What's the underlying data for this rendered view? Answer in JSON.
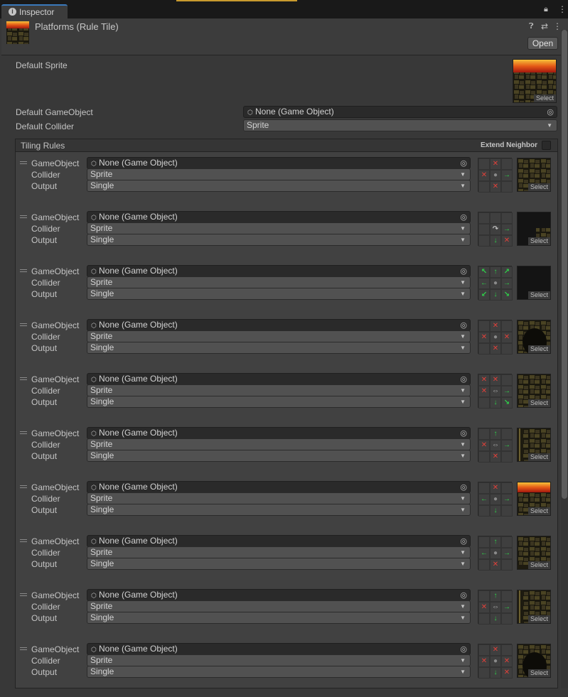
{
  "window": {
    "tab_label": "Inspector",
    "lock_icon": "lock-icon",
    "menu_icon": "kebab-icon"
  },
  "asset": {
    "title": "Platforms (Rule Tile)",
    "open_label": "Open",
    "help_icon": "help-icon",
    "preset_icon": "preset-icon"
  },
  "defaults": {
    "sprite_label": "Default Sprite",
    "gameobject_label": "Default GameObject",
    "gameobject_value": "None (Game Object)",
    "collider_label": "Default Collider",
    "collider_value": "Sprite",
    "select_label": "Select"
  },
  "tiling": {
    "title": "Tiling Rules",
    "extend_label": "Extend Neighbor"
  },
  "rule_labels": {
    "gameobject": "GameObject",
    "collider": "Collider",
    "output": "Output"
  },
  "rules": [
    {
      "gameobject": "None (Game Object)",
      "collider": "Sprite",
      "output": "Single",
      "grid": [
        "",
        "x",
        "",
        "x",
        "o",
        "a-right",
        "",
        "x",
        ""
      ],
      "sprite": "platform-tile",
      "select": "Select"
    },
    {
      "gameobject": "None (Game Object)",
      "collider": "Sprite",
      "output": "Single",
      "grid": [
        "",
        "",
        "",
        "",
        "r-rotate",
        "a-right",
        "",
        "a-down",
        "x"
      ],
      "sprite": "corner-dark-tile",
      "select": "Select"
    },
    {
      "gameobject": "None (Game Object)",
      "collider": "Sprite",
      "output": "Single",
      "grid": [
        "a-upleft",
        "a-up",
        "a-upright",
        "a-left",
        "o",
        "a-right",
        "a-downleft",
        "a-down",
        "a-downright"
      ],
      "sprite": "empty-dark-tile",
      "select": "Select"
    },
    {
      "gameobject": "None (Game Object)",
      "collider": "Sprite",
      "output": "Single",
      "grid": [
        "",
        "x",
        "",
        "x",
        "o",
        "x",
        "",
        "x",
        ""
      ],
      "sprite": "cave-tile",
      "select": "Select"
    },
    {
      "gameobject": "None (Game Object)",
      "collider": "Sprite",
      "output": "Single",
      "grid": [
        "x",
        "x",
        "",
        "x",
        "r-mirror",
        "a-right",
        "",
        "a-down",
        "a-downright"
      ],
      "sprite": "platform-tile",
      "select": "Select"
    },
    {
      "gameobject": "None (Game Object)",
      "collider": "Sprite",
      "output": "Single",
      "grid": [
        "",
        "a-up",
        "",
        "x",
        "r-mirror",
        "a-right",
        "",
        "x",
        ""
      ],
      "sprite": "left-edge-tile",
      "select": "Select"
    },
    {
      "gameobject": "None (Game Object)",
      "collider": "Sprite",
      "output": "Single",
      "grid": [
        "",
        "x",
        "",
        "a-left",
        "o",
        "a-right",
        "",
        "a-down",
        ""
      ],
      "sprite": "lava-tile",
      "select": "Select"
    },
    {
      "gameobject": "None (Game Object)",
      "collider": "Sprite",
      "output": "Single",
      "grid": [
        "",
        "a-up",
        "",
        "a-left",
        "o",
        "a-right",
        "",
        "x",
        ""
      ],
      "sprite": "bottom-tile",
      "select": "Select"
    },
    {
      "gameobject": "None (Game Object)",
      "collider": "Sprite",
      "output": "Single",
      "grid": [
        "",
        "a-up",
        "",
        "x",
        "r-mirror",
        "a-right",
        "",
        "a-down",
        ""
      ],
      "sprite": "left-edge-tile",
      "select": "Select"
    },
    {
      "gameobject": "None (Game Object)",
      "collider": "Sprite",
      "output": "Single",
      "grid": [
        "",
        "x",
        "",
        "x",
        "o",
        "x",
        "",
        "a-down",
        "x"
      ],
      "sprite": "cave-tile",
      "select": "Select"
    }
  ]
}
